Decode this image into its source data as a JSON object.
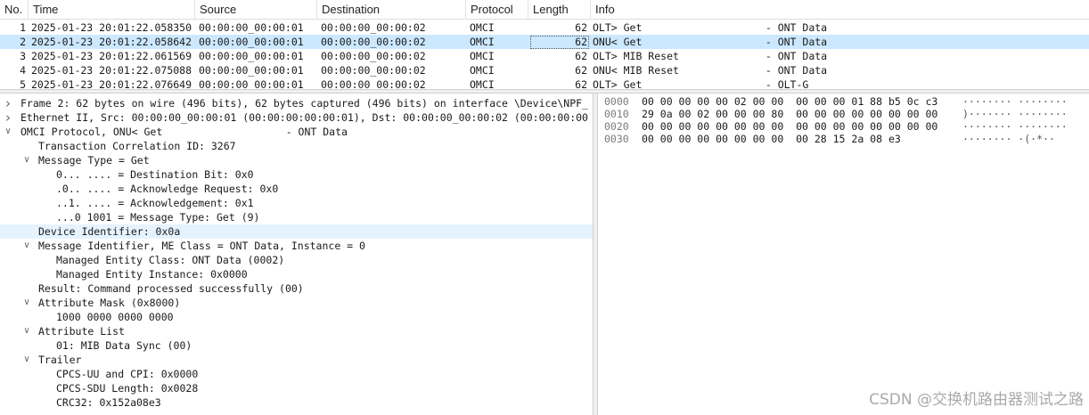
{
  "packet_list": {
    "columns": [
      "No.",
      "Time",
      "Source",
      "Destination",
      "Protocol",
      "Length",
      "Info"
    ],
    "rows": [
      {
        "no": "1",
        "time": "2025-01-23 20:01:22.058350",
        "src": "00:00:00_00:00:01",
        "dst": "00:00:00_00:00:02",
        "proto": "OMCI",
        "len": "62",
        "info": "OLT> Get                    - ONT Data"
      },
      {
        "no": "2",
        "time": "2025-01-23 20:01:22.058642",
        "src": "00:00:00_00:00:01",
        "dst": "00:00:00_00:00:02",
        "proto": "OMCI",
        "len": "62",
        "info": "ONU< Get                    - ONT Data"
      },
      {
        "no": "3",
        "time": "2025-01-23 20:01:22.061569",
        "src": "00:00:00_00:00:01",
        "dst": "00:00:00_00:00:02",
        "proto": "OMCI",
        "len": "62",
        "info": "OLT> MIB Reset              - ONT Data"
      },
      {
        "no": "4",
        "time": "2025-01-23 20:01:22.075088",
        "src": "00:00:00_00:00:01",
        "dst": "00:00:00_00:00:02",
        "proto": "OMCI",
        "len": "62",
        "info": "ONU< MIB Reset              - ONT Data"
      },
      {
        "no": "5",
        "time": "2025-01-23 20:01:22.076649",
        "src": "00:00:00_00:00:01",
        "dst": "00:00:00_00:00:02",
        "proto": "OMCI",
        "len": "62",
        "info": "OLT> Get                    - OLT-G"
      }
    ]
  },
  "details": [
    {
      "text": "Frame 2: 62 bytes on wire (496 bits), 62 bytes captured (496 bits) on interface \\Device\\NPF_",
      "arrow": "right",
      "indent": 0
    },
    {
      "text": "Ethernet II, Src: 00:00:00_00:00:01 (00:00:00:00:00:01), Dst: 00:00:00_00:00:02 (00:00:00:00",
      "arrow": "right",
      "indent": 0
    },
    {
      "text": "OMCI Protocol, ONU< Get                    - ONT Data",
      "arrow": "down",
      "indent": 0
    },
    {
      "text": "Transaction Correlation ID: 3267",
      "arrow": "",
      "indent": 1
    },
    {
      "text": "Message Type = Get",
      "arrow": "down",
      "indent": 1
    },
    {
      "text": "0... .... = Destination Bit: 0x0",
      "arrow": "",
      "indent": 2
    },
    {
      "text": ".0.. .... = Acknowledge Request: 0x0",
      "arrow": "",
      "indent": 2
    },
    {
      "text": "..1. .... = Acknowledgement: 0x1",
      "arrow": "",
      "indent": 2
    },
    {
      "text": "...0 1001 = Message Type: Get (9)",
      "arrow": "",
      "indent": 2
    },
    {
      "text": "Device Identifier: 0x0a",
      "arrow": "",
      "indent": 1,
      "selected": true
    },
    {
      "text": "Message Identifier, ME Class = ONT Data, Instance = 0",
      "arrow": "down",
      "indent": 1
    },
    {
      "text": "Managed Entity Class: ONT Data (0002)",
      "arrow": "",
      "indent": 2
    },
    {
      "text": "Managed Entity Instance: 0x0000",
      "arrow": "",
      "indent": 2
    },
    {
      "text": "Result: Command processed successfully (00)",
      "arrow": "",
      "indent": 1
    },
    {
      "text": "Attribute Mask (0x8000)",
      "arrow": "down",
      "indent": 1
    },
    {
      "text": "1000 0000 0000 0000",
      "arrow": "",
      "indent": 2
    },
    {
      "text": "Attribute List",
      "arrow": "down",
      "indent": 1
    },
    {
      "text": "01: MIB Data Sync (00)",
      "arrow": "",
      "indent": 2
    },
    {
      "text": "Trailer",
      "arrow": "down",
      "indent": 1
    },
    {
      "text": "CPCS-UU and CPI: 0x0000",
      "arrow": "",
      "indent": 2
    },
    {
      "text": "CPCS-SDU Length: 0x0028",
      "arrow": "",
      "indent": 2
    },
    {
      "text": "CRC32: 0x152a08e3",
      "arrow": "",
      "indent": 2
    }
  ],
  "bytes": [
    {
      "offset": "0000",
      "hex": "00 00 00 00 00 02 00 00  00 00 00 01 88 b5 0c c3",
      "ascii": "········ ········"
    },
    {
      "offset": "0010",
      "hex": "29 0a 00 02 00 00 00 80  00 00 00 00 00 00 00 00",
      "ascii": ")······· ········"
    },
    {
      "offset": "0020",
      "hex": "00 00 00 00 00 00 00 00  00 00 00 00 00 00 00 00",
      "ascii": "········ ········"
    },
    {
      "offset": "0030",
      "hex": "00 00 00 00 00 00 00 00  00 28 15 2a 08 e3",
      "ascii": "········ ·(·*··"
    }
  ],
  "watermark": "CSDN @交换机路由器测试之路",
  "colors": {
    "selected_row": "#cce8ff",
    "selected_detail": "#e5f3ff"
  }
}
